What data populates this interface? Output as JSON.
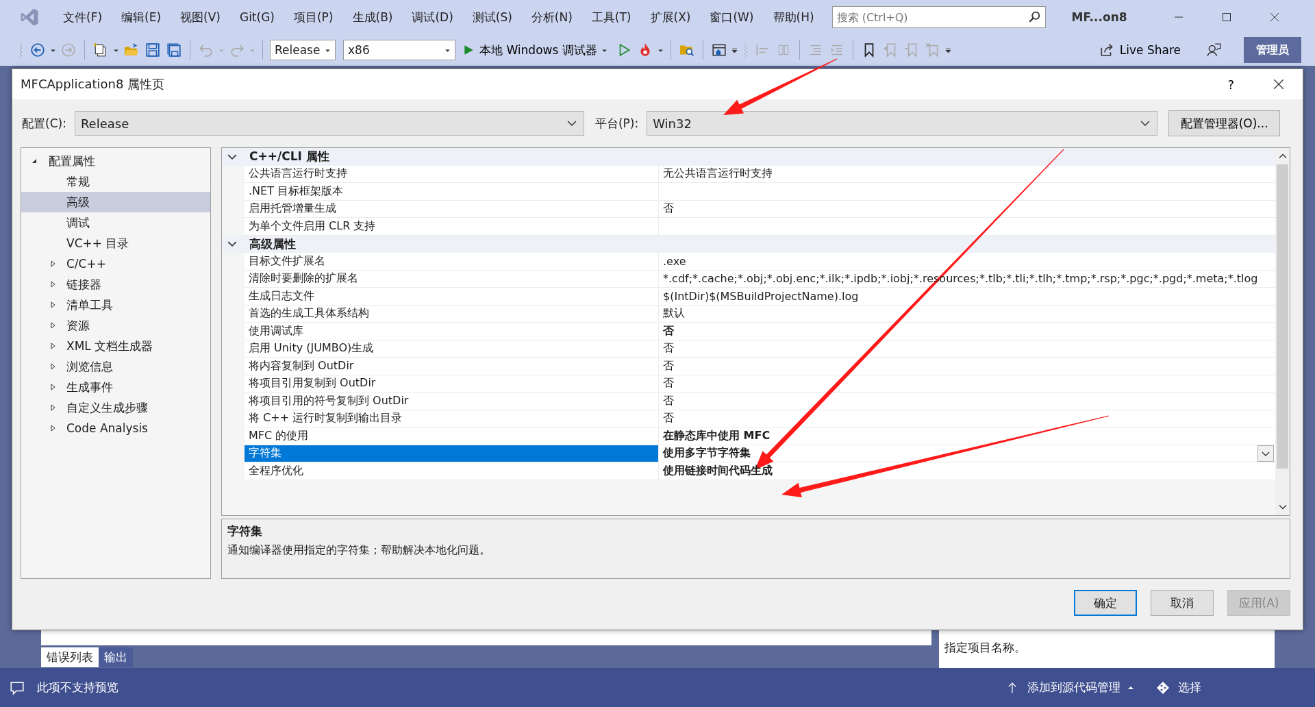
{
  "menu": [
    {
      "label": "文件(F)"
    },
    {
      "label": "编辑(E)"
    },
    {
      "label": "视图(V)"
    },
    {
      "label": "Git(G)"
    },
    {
      "label": "项目(P)"
    },
    {
      "label": "生成(B)"
    },
    {
      "label": "调试(D)"
    },
    {
      "label": "测试(S)"
    },
    {
      "label": "分析(N)"
    },
    {
      "label": "工具(T)"
    },
    {
      "label": "扩展(X)"
    },
    {
      "label": "窗口(W)"
    },
    {
      "label": "帮助(H)"
    }
  ],
  "search": {
    "placeholder": "搜索 (Ctrl+Q)"
  },
  "window_title": "MF...on8",
  "toolbar": {
    "configuration": "Release",
    "platform": "x86",
    "run_label": "本地 Windows 调试器",
    "live_share": "Live Share",
    "admin": "管理员"
  },
  "dialog": {
    "title": "MFCApplication8 属性页",
    "help": "?",
    "config_label": "配置(C):",
    "config_value": "Release",
    "platform_label": "平台(P):",
    "platform_value": "Win32",
    "config_manager": "配置管理器(O)...",
    "tree": [
      {
        "label": "配置属性",
        "expanded": true,
        "children": [
          {
            "label": "常规",
            "selected": false
          },
          {
            "label": "高级",
            "selected": true
          },
          {
            "label": "调试",
            "selected": false
          },
          {
            "label": "VC++ 目录",
            "selected": false
          },
          {
            "label": "C/C++",
            "selected": false,
            "expanded": false
          },
          {
            "label": "链接器",
            "selected": false,
            "expanded": false
          },
          {
            "label": "清单工具",
            "selected": false,
            "expanded": false
          },
          {
            "label": "资源",
            "selected": false,
            "expanded": false
          },
          {
            "label": "XML 文档生成器",
            "selected": false,
            "expanded": false
          },
          {
            "label": "浏览信息",
            "selected": false,
            "expanded": false
          },
          {
            "label": "生成事件",
            "selected": false,
            "expanded": false
          },
          {
            "label": "自定义生成步骤",
            "selected": false,
            "expanded": false
          },
          {
            "label": "Code Analysis",
            "selected": false,
            "expanded": false
          }
        ]
      }
    ],
    "sections": [
      {
        "name": "C++/CLI 属性",
        "expanded": true,
        "rows": [
          {
            "name": "公共语言运行时支持",
            "value": "无公共语言运行时支持",
            "modified": false,
            "selected": false
          },
          {
            "name": ".NET 目标框架版本",
            "selected": false
          },
          {
            "name": "启用托管增量生成",
            "value": "否",
            "modified": false,
            "selected": false
          },
          {
            "name": "为单个文件启用 CLR 支持",
            "selected": false
          }
        ]
      },
      {
        "name": "高级属性",
        "expanded": true,
        "rows": [
          {
            "name": "目标文件扩展名",
            "value": ".exe",
            "modified": false,
            "selected": false
          },
          {
            "name": "清除时要删除的扩展名",
            "value": "*.cdf;*.cache;*.obj;*.obj.enc;*.ilk;*.ipdb;*.iobj;*.resources;*.tlb;*.tli;*.tlh;*.tmp;*.rsp;*.pgc;*.pgd;*.meta;*.tlog",
            "modified": false,
            "selected": false
          },
          {
            "name": "生成日志文件",
            "value": "$(IntDir)$(MSBuildProjectName).log",
            "modified": false,
            "selected": false
          },
          {
            "name": "首选的生成工具体系结构",
            "value": "默认",
            "modified": false,
            "selected": false
          },
          {
            "name": "使用调试库",
            "value": "否",
            "modified": true,
            "selected": false
          },
          {
            "name": "启用 Unity (JUMBO)生成",
            "value": "否",
            "modified": false,
            "selected": false
          },
          {
            "name": "将内容复制到 OutDir",
            "value": "否",
            "modified": false,
            "selected": false
          },
          {
            "name": "将项目引用复制到 OutDir",
            "value": "否",
            "modified": false,
            "selected": false
          },
          {
            "name": "将项目引用的符号复制到 OutDir",
            "value": "否",
            "modified": false,
            "selected": false
          },
          {
            "name": "将 C++ 运行时复制到输出目录",
            "value": "否",
            "modified": false,
            "selected": false
          },
          {
            "name": "MFC 的使用",
            "value": "在静态库中使用 MFC",
            "modified": true,
            "selected": false
          },
          {
            "name": "字符集",
            "value": "使用多字节字符集",
            "modified": true,
            "selected": true
          },
          {
            "name": "全程序优化",
            "value": "使用链接时间代码生成",
            "modified": true,
            "selected": false
          }
        ]
      }
    ],
    "description": {
      "title": "字符集",
      "text": "通知编译器使用指定的字符集；帮助解决本地化问题。"
    },
    "buttons": [
      {
        "label": "确定",
        "default": true,
        "disabled": false
      },
      {
        "label": "取消",
        "default": false,
        "disabled": false
      },
      {
        "label": "应用(A)",
        "default": false,
        "disabled": true
      }
    ]
  },
  "panel_tabs": [
    {
      "label": "错误列表",
      "selected": true
    },
    {
      "label": "输出",
      "selected": false
    }
  ],
  "side_panel_text": "指定项目名称。",
  "status_bar": {
    "message": "此项不支持预览",
    "source_control": "添加到源代码管理",
    "select": "选择"
  }
}
